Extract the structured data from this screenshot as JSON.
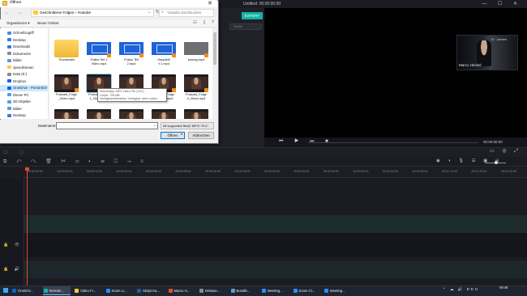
{
  "editor": {
    "title": "Untitled:",
    "title_time": "00:00:00:00",
    "export_label": "EXPORT",
    "media_search_placeholder": "Suche",
    "preview_time": "00:00:00:00",
    "webcam_name": "Marco Heckel",
    "webcam_tag": "O · Lernen",
    "timeline_ticks": [
      "00:00:00:00",
      "00:00:05:00",
      "00:00:10:00",
      "00:00:15:00",
      "00:00:20:00",
      "00:00:25:00",
      "00:00:30:00",
      "00:00:35:00",
      "00:00:40:00",
      "00:00:45:00",
      "00:00:50:00",
      "00:00:55:00",
      "00:01:00:00",
      "00:01:05:00",
      "00:01:10:00",
      "00:01:15:00",
      "00:01:20:00"
    ]
  },
  "dialog": {
    "title": "Öffnen",
    "address": "Geschnittene Folgen  ›  Youtube",
    "search_placeholder": "Youtube durchsuchen",
    "organize_label": "Organisieren ▾",
    "new_folder_label": "Neuer Ordner",
    "sidebar": [
      {
        "label": "Schnellzugriff",
        "color": "#3c8fe8",
        "selected": false
      },
      {
        "label": "Desktop",
        "color": "#2e7ed6",
        "selected": false
      },
      {
        "label": "Downloads",
        "color": "#2e7ed6",
        "selected": false
      },
      {
        "label": "Dokumente",
        "color": "#8a8a8a",
        "selected": false
      },
      {
        "label": "Bilder",
        "color": "#5a9bd8",
        "selected": false
      },
      {
        "label": "speedStream",
        "color": "#ffc83d",
        "selected": false
      },
      {
        "label": "Data (E:)",
        "color": "#8a8a8a",
        "selected": false
      },
      {
        "label": "Dropbox",
        "color": "#0061fe",
        "selected": false
      },
      {
        "label": "OneDrive - Persönlich",
        "color": "#0a64d2",
        "selected": true
      },
      {
        "label": "Dieser PC",
        "color": "#5a9bd8",
        "selected": false
      },
      {
        "label": "3D-Objekte",
        "color": "#4aa3df",
        "selected": false
      },
      {
        "label": "Bilder",
        "color": "#5a9bd8",
        "selected": false
      },
      {
        "label": "Desktop",
        "color": "#2e7ed6",
        "selected": false
      }
    ],
    "files": [
      {
        "label": "Thumbnails",
        "kind": "folder"
      },
      {
        "label": "Frakio Teil 1\nVideo.mp4",
        "kind": "blue"
      },
      {
        "label": "Frakio Teil\n2.mp4",
        "kind": "blue"
      },
      {
        "label": "Hauptstil\nY.1.mp4",
        "kind": "blue"
      },
      {
        "label": "bumag.mp4",
        "kind": "gray"
      },
      {
        "label": "Podcast_Folge\n_Video.mp4",
        "kind": "dark"
      },
      {
        "label": "Podcast_Folge\n1_Video.mp4",
        "kind": "dark"
      },
      {
        "label": "Podcast_Folge\n2_Video.mp4",
        "kind": "dark"
      },
      {
        "label": "Podcast_Folge\n3_Video.mp4",
        "kind": "dark"
      },
      {
        "label": "Podcast_Folge\n4_Video.mp4",
        "kind": "dark"
      },
      {
        "label": "",
        "kind": "dark"
      },
      {
        "label": "",
        "kind": "dark"
      },
      {
        "label": "",
        "kind": "dark"
      },
      {
        "label": "",
        "kind": "dark"
      },
      {
        "label": "",
        "kind": "dark"
      }
    ],
    "tooltip": "Elementtyp: MP4 Video File (VLC)\nGröße: 726 MB\nVerfügbarkeitsstatus: Verfügbar, wenn online",
    "filename_label": "Dateiname:",
    "filename_value": "",
    "filetype_value": "All supported files(*.MP4;*.FLV;",
    "open_label": "Öffnen",
    "cancel_label": "Abbrechen"
  },
  "taskbar": {
    "items": [
      {
        "label": "OneDriv...",
        "color": "#0a64d2",
        "active": false
      },
      {
        "label": "Wonder...",
        "color": "#12b3a8",
        "active": true
      },
      {
        "label": "Video Fi...",
        "color": "#ffc83d",
        "active": false
      },
      {
        "label": "Zoom Li...",
        "color": "#2d8cff",
        "active": false
      },
      {
        "label": "Skript Ka...",
        "color": "#2b579a",
        "active": false
      },
      {
        "label": "Marco H...",
        "color": "#e34c26",
        "active": false
      },
      {
        "label": "Debase...",
        "color": "#8a8a8a",
        "active": false
      },
      {
        "label": "Bundle...",
        "color": "#5b9bd5",
        "active": false
      },
      {
        "label": "Meeting...",
        "color": "#2d8cff",
        "active": false
      },
      {
        "label": "Zoom Cl...",
        "color": "#2d8cff",
        "active": false
      },
      {
        "label": "Meeting...",
        "color": "#2d8cff",
        "active": false
      }
    ],
    "tray": "⌃ ☁ 🔊 DEU",
    "time": "09:46",
    "date": ""
  }
}
